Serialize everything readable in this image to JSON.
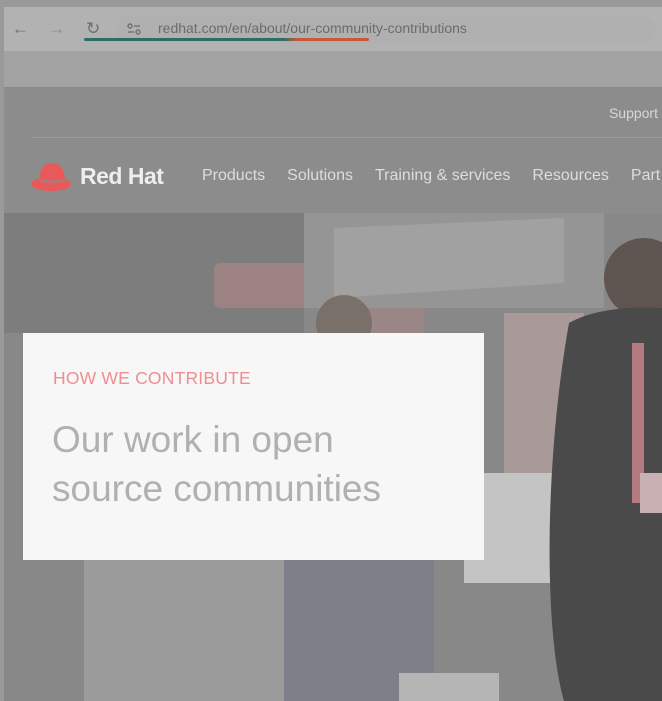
{
  "browser": {
    "url": "redhat.com/en/about/our-community-contributions",
    "colors": {
      "progress_start": "#2f6d62",
      "progress_end": "#c65a3c"
    }
  },
  "header": {
    "utility": {
      "support_label": "Support"
    },
    "logo": {
      "text": "Red Hat",
      "icon": "red-fedora-icon",
      "brand_color": "#e85a5a"
    },
    "nav": [
      "Products",
      "Solutions",
      "Training & services",
      "Resources",
      "Part"
    ]
  },
  "hero": {
    "eyebrow": "HOW WE CONTRIBUTE",
    "title_line1": "Our work in open",
    "title_line2": "source communities"
  }
}
